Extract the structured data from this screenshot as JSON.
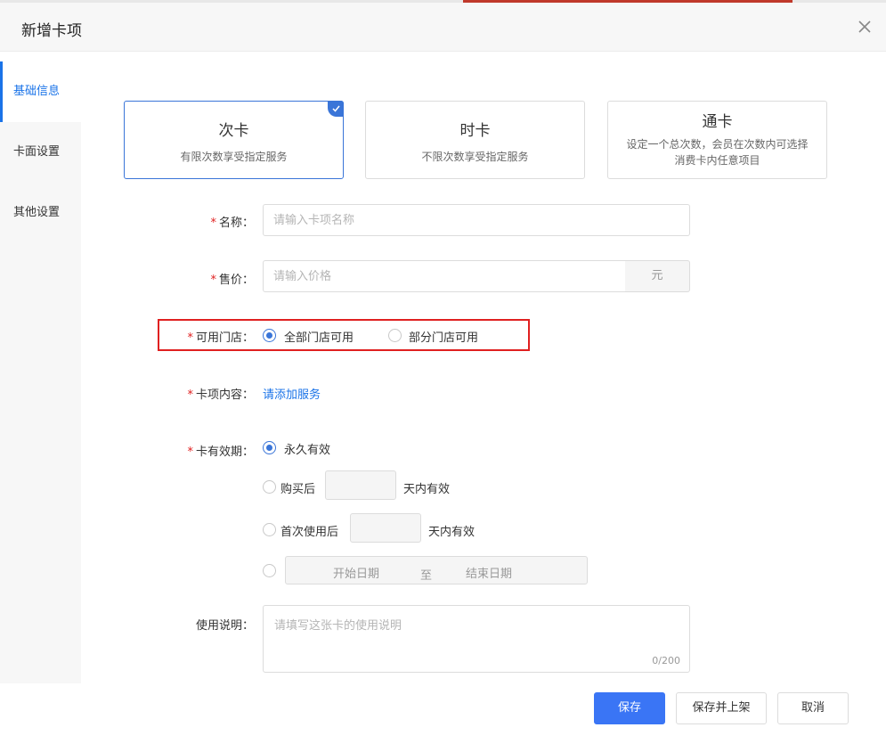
{
  "dialog": {
    "title": "新增卡项"
  },
  "sidebar": {
    "items": [
      {
        "label": "基础信息"
      },
      {
        "label": "卡面设置"
      },
      {
        "label": "其他设置"
      }
    ]
  },
  "card_types": [
    {
      "title": "次卡",
      "desc": "有限次数享受指定服务",
      "selected": true
    },
    {
      "title": "时卡",
      "desc": "不限次数享受指定服务",
      "selected": false
    },
    {
      "title": "通卡",
      "desc_line1": "设定一个总次数，会员在次数内可选择",
      "desc_line2": "消费卡内任意项目",
      "selected": false
    }
  ],
  "form": {
    "required_mark": "*",
    "name": {
      "label": "名称：",
      "placeholder": "请输入卡项名称"
    },
    "price": {
      "label": "售价：",
      "placeholder": "请输入价格",
      "unit": "元"
    },
    "stores": {
      "label": "可用门店：",
      "option_all": "全部门店可用",
      "option_partial": "部分门店可用"
    },
    "content": {
      "label": "卡项内容：",
      "link": "请添加服务"
    },
    "validity": {
      "label": "卡有效期：",
      "option_forever": "永久有效",
      "option_after_purchase": "购买后",
      "option_after_first_use": "首次使用后",
      "days_suffix": "天内有效",
      "start_date": "开始日期",
      "to": "至",
      "end_date": "结束日期"
    },
    "usage": {
      "label": "使用说明：",
      "placeholder": "请填写这张卡的使用说明",
      "count": "0/200"
    }
  },
  "footer": {
    "save": "保存",
    "save_and_publish": "保存并上架",
    "cancel": "取消"
  },
  "colors": {
    "accent": "#3a75f5",
    "required": "#e02020",
    "link": "#1a73e8"
  }
}
